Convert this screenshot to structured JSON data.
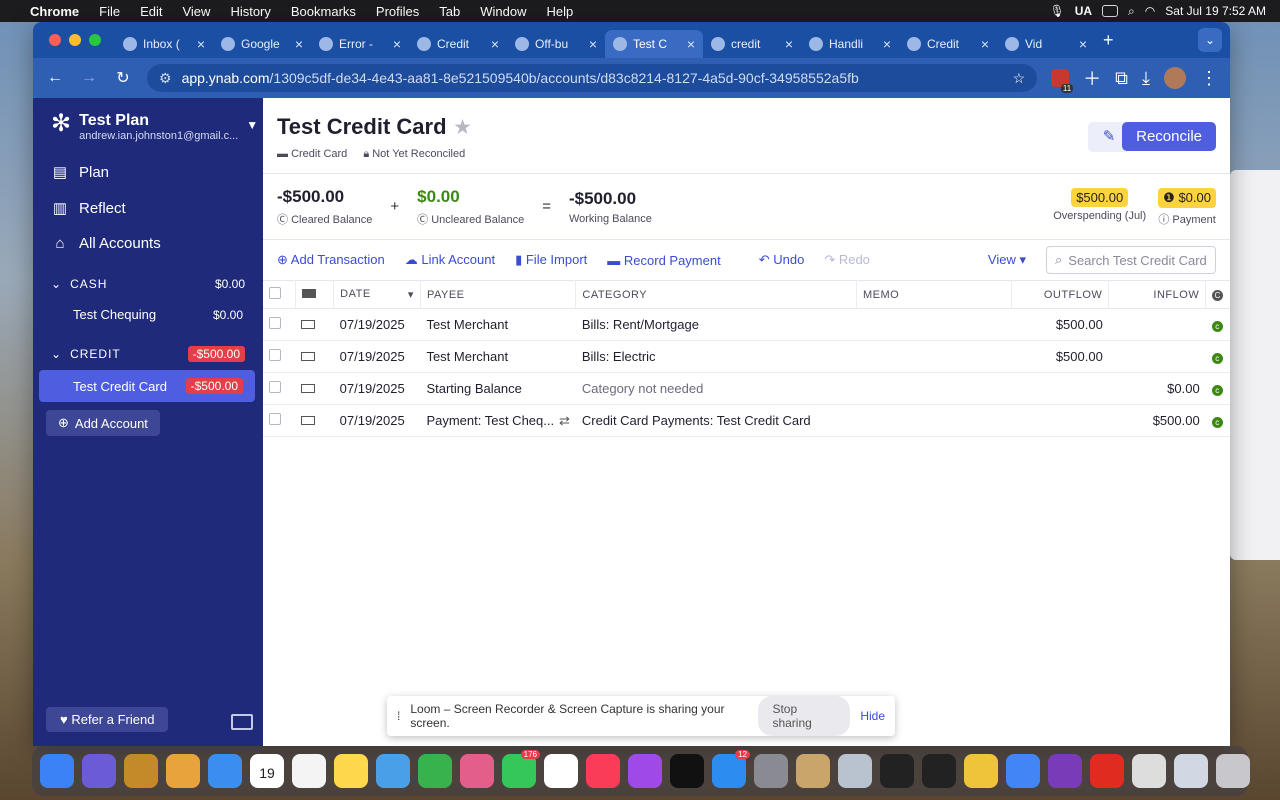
{
  "menubar": {
    "app": "Chrome",
    "items": [
      "File",
      "Edit",
      "View",
      "History",
      "Bookmarks",
      "Profiles",
      "Tab",
      "Window",
      "Help"
    ],
    "ua": "UA",
    "datetime": "Sat Jul 19  7:52 AM"
  },
  "tabs": [
    {
      "label": "Inbox ("
    },
    {
      "label": "Google"
    },
    {
      "label": "Error -"
    },
    {
      "label": "Credit"
    },
    {
      "label": "Off-bu"
    },
    {
      "label": "Test C"
    },
    {
      "label": "credit"
    },
    {
      "label": "Handli"
    },
    {
      "label": "Credit"
    },
    {
      "label": "Vid"
    }
  ],
  "active_tab": 5,
  "address": {
    "host": "app.ynab.com",
    "path": "/1309c5df-de34-4e43-aa81-8e521509540b/accounts/d83c8214-8127-4a5d-90cf-34958552a5fb",
    "ext_badge": "11"
  },
  "sidebar": {
    "budget_name": "Test Plan",
    "email": "andrew.ian.johnston1@gmail.c...",
    "nav": [
      "Plan",
      "Reflect",
      "All Accounts"
    ],
    "groups": [
      {
        "name": "CASH",
        "amount": "$0.00",
        "accounts": [
          {
            "name": "Test Chequing",
            "amount": "$0.00"
          }
        ]
      },
      {
        "name": "CREDIT",
        "amount": "-$500.00",
        "accounts": [
          {
            "name": "Test Credit Card",
            "amount": "-$500.00"
          }
        ]
      }
    ],
    "add_account": "Add Account",
    "refer": "Refer a Friend"
  },
  "header": {
    "title": "Test Credit Card",
    "type": "Credit Card",
    "recon_status": "Not Yet Reconciled",
    "reconcile": "Reconcile"
  },
  "balances": {
    "cleared": "-$500.00",
    "cleared_label": "Cleared Balance",
    "plus": "+",
    "uncleared": "$0.00",
    "uncleared_label": "Uncleared Balance",
    "eq": "=",
    "working": "-$500.00",
    "working_label": "Working Balance",
    "overspending": "$500.00",
    "overspending_label": "Overspending (Jul)",
    "payment": "$0.00",
    "payment_label": "Payment"
  },
  "toolbar": {
    "add": "Add Transaction",
    "link": "Link Account",
    "import": "File Import",
    "record": "Record Payment",
    "undo": "Undo",
    "redo": "Redo",
    "view": "View",
    "search_placeholder": "Search Test Credit Card"
  },
  "columns": {
    "date": "DATE",
    "payee": "PAYEE",
    "category": "CATEGORY",
    "memo": "MEMO",
    "outflow": "OUTFLOW",
    "inflow": "INFLOW"
  },
  "rows": [
    {
      "date": "07/19/2025",
      "payee": "Test Merchant",
      "category": "Bills: Rent/Mortgage",
      "memo": "",
      "outflow": "$500.00",
      "inflow": ""
    },
    {
      "date": "07/19/2025",
      "payee": "Test Merchant",
      "category": "Bills: Electric",
      "memo": "",
      "outflow": "$500.00",
      "inflow": ""
    },
    {
      "date": "07/19/2025",
      "payee": "Starting Balance",
      "category": "Category not needed",
      "memo": "",
      "outflow": "",
      "inflow": "$0.00"
    },
    {
      "date": "07/19/2025",
      "payee": "Payment: Test Cheq...",
      "category": "Credit Card Payments: Test Credit Card",
      "memo": "",
      "outflow": "",
      "inflow": "$500.00"
    }
  ],
  "loom": {
    "text": "Loom – Screen Recorder & Screen Capture is sharing your screen.",
    "stop": "Stop sharing",
    "hide": "Hide"
  },
  "help": "?",
  "dock": {
    "calendar_day": "19",
    "badge_messages": "176",
    "badge_appstore": "12"
  }
}
